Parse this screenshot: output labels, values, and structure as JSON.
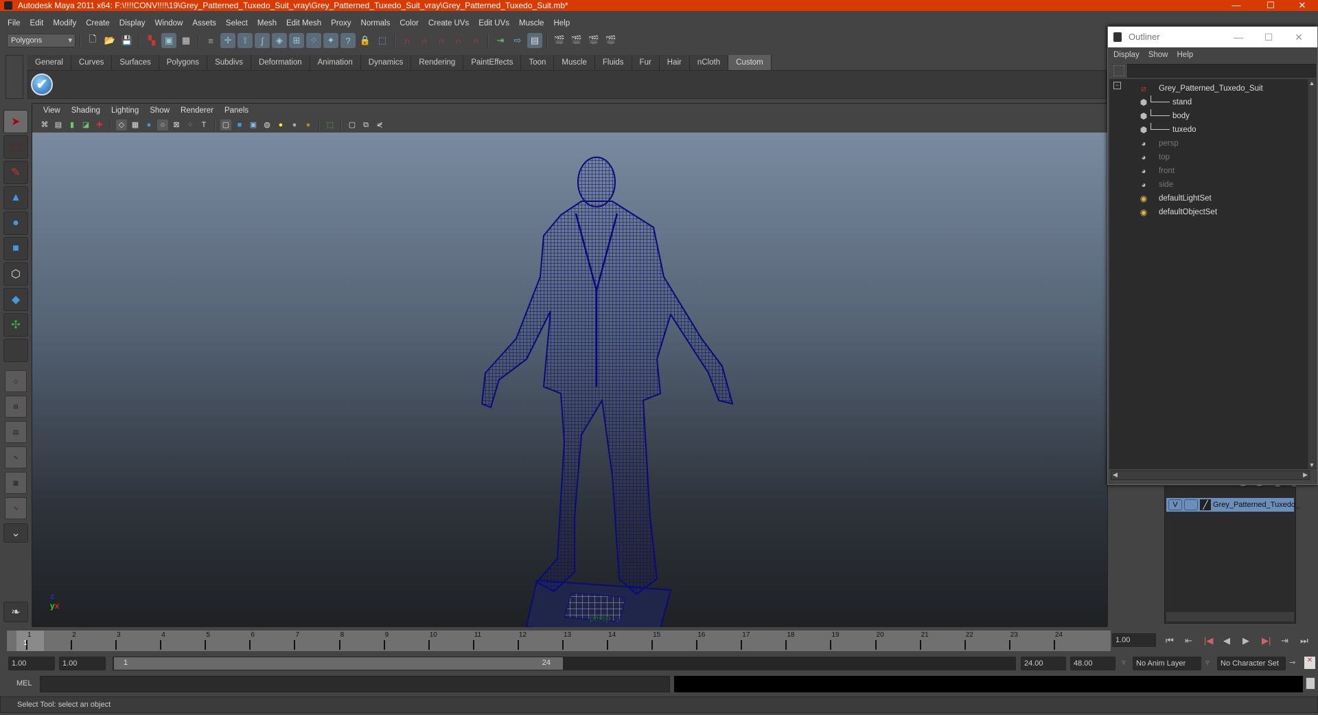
{
  "window": {
    "title": "Autodesk Maya 2011 x64: F:\\!!!!CONV!!!!\\19\\Grey_Patterned_Tuxedo_Suit_vray\\Grey_Patterned_Tuxedo_Suit_vray\\Grey_Patterned_Tuxedo_Suit.mb*",
    "minimize": "—",
    "maximize": "☐",
    "close": "✕"
  },
  "menubar": [
    "File",
    "Edit",
    "Modify",
    "Create",
    "Display",
    "Window",
    "Assets",
    "Select",
    "Mesh",
    "Edit Mesh",
    "Proxy",
    "Normals",
    "Color",
    "Create UVs",
    "Edit UVs",
    "Muscle",
    "Help"
  ],
  "toolbar": {
    "mode": "Polygons",
    "icons": [
      "new-scene-icon",
      "open-scene-icon",
      "save-scene-icon",
      "select-hierarchy-icon",
      "select-object-icon",
      "select-component-icon",
      "selection-mask-icon",
      "snap-grid-icon",
      "snap-curve-icon",
      "snap-point-icon",
      "snap-plane-icon",
      "snap-live-icon",
      "history-icon",
      "help-icon",
      "lock-icon",
      "render-region-icon",
      "magnet-grid-icon",
      "magnet-curve-icon",
      "magnet-point-icon",
      "magnet-view-icon",
      "magnet-live-icon",
      "input-ops-icon",
      "output-ops-icon",
      "construction-history-icon",
      "render-view-icon",
      "render-frame-icon",
      "ipr-render-icon",
      "render-settings-icon"
    ]
  },
  "shelf": {
    "tabs": [
      "General",
      "Curves",
      "Surfaces",
      "Polygons",
      "Subdivs",
      "Deformation",
      "Animation",
      "Dynamics",
      "Rendering",
      "PaintEffects",
      "Toon",
      "Muscle",
      "Fluids",
      "Fur",
      "Hair",
      "nCloth",
      "Custom"
    ],
    "active_tab": "Custom",
    "check_glyph": "✔"
  },
  "toolbox": [
    "select-tool",
    "lasso-tool",
    "paint-select-tool",
    "move-tool",
    "rotate-tool",
    "scale-tool",
    "universal-manipulator",
    "soft-mod-tool",
    "show-manipulator",
    "last-tool"
  ],
  "viewport": {
    "menus": [
      "View",
      "Shading",
      "Lighting",
      "Show",
      "Renderer",
      "Panels"
    ],
    "camera": "persp",
    "axis": {
      "z": "z",
      "y": "y",
      "x": "x"
    },
    "wire_color": "#0a0a7a"
  },
  "timeline": {
    "ticks": [
      "1",
      "2",
      "3",
      "4",
      "5",
      "6",
      "7",
      "8",
      "9",
      "10",
      "11",
      "12",
      "13",
      "14",
      "15",
      "16",
      "17",
      "18",
      "19",
      "20",
      "21",
      "22",
      "23",
      "24"
    ],
    "current_frame": "1",
    "current_time_field": "1.00"
  },
  "playback": {
    "buttons": [
      "⏮",
      "⇤",
      "|◀",
      "◀",
      "▶",
      "▶|",
      "⇥",
      "⏭"
    ]
  },
  "range": {
    "start": "1.00",
    "playback_start": "1.00",
    "slider_start": "1",
    "slider_end": "24",
    "playback_end": "24.00",
    "end": "48.00",
    "anim_layer": "No Anim Layer",
    "character_set": "No Character Set"
  },
  "command_line": {
    "label": "MEL",
    "value": "",
    "result": ""
  },
  "status_line": "Select Tool: select an object",
  "outliner": {
    "title": "Outliner",
    "menus": [
      "Display",
      "Show",
      "Help"
    ],
    "filter": "",
    "items": [
      {
        "name": "Grey_Patterned_Tuxedo_Suit",
        "icon": "group-icon",
        "dim": false,
        "indent": 0
      },
      {
        "name": "stand",
        "icon": "mesh-icon",
        "dim": false,
        "indent": 1
      },
      {
        "name": "body",
        "icon": "mesh-icon",
        "dim": false,
        "indent": 1
      },
      {
        "name": "tuxedo",
        "icon": "mesh-icon",
        "dim": false,
        "indent": 1
      },
      {
        "name": "persp",
        "icon": "camera-icon",
        "dim": true,
        "indent": 0
      },
      {
        "name": "top",
        "icon": "camera-icon",
        "dim": true,
        "indent": 0
      },
      {
        "name": "front",
        "icon": "camera-icon",
        "dim": true,
        "indent": 0
      },
      {
        "name": "side",
        "icon": "camera-icon",
        "dim": true,
        "indent": 0
      },
      {
        "name": "defaultLightSet",
        "icon": "set-icon",
        "dim": false,
        "indent": 0
      },
      {
        "name": "defaultObjectSet",
        "icon": "set-icon",
        "dim": false,
        "indent": 0
      }
    ]
  },
  "layer_editor": {
    "layer": {
      "visible": "V",
      "name": "Grey_Patterned_Tuxedo_"
    }
  }
}
